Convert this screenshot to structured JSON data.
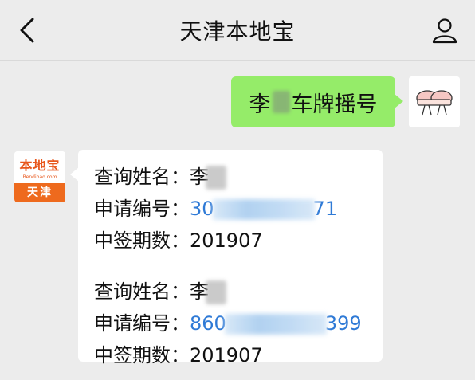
{
  "nav": {
    "title": "天津本地宝",
    "back_icon": "chevron-left-icon",
    "profile_icon": "person-icon"
  },
  "outgoing": {
    "text_prefix": "李",
    "text_suffix": "车牌摇号",
    "bubble_color": "#95ec69"
  },
  "bot_avatar": {
    "logo_text": "本地宝",
    "logo_sub": "Bendibao.com",
    "city": "天津",
    "accent": "#ee6a1d"
  },
  "reply": {
    "records": [
      {
        "name_label": "查询姓名：",
        "name_value": "李",
        "app_label": "申请编号：",
        "app_prefix": "30",
        "app_suffix": "71",
        "period_label": "中签期数：",
        "period_value": "201907"
      },
      {
        "name_label": "查询姓名：",
        "name_value": "李",
        "app_label": "申请编号：",
        "app_prefix": "860",
        "app_suffix": "399",
        "period_label": "中签期数：",
        "period_value": "201907"
      }
    ],
    "link_color": "#2f7ad6"
  }
}
